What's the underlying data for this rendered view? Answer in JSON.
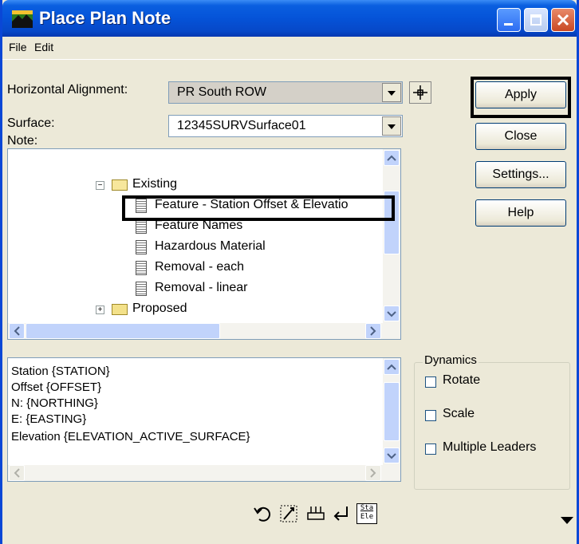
{
  "window": {
    "title": "Place Plan Note",
    "accent": "#0553d8"
  },
  "menu": {
    "file": "File",
    "edit": "Edit"
  },
  "form": {
    "alignment_label": "Horizontal Alignment:",
    "alignment_value": "PR South ROW",
    "surface_label": "Surface:",
    "surface_value": "12345SURVSurface01",
    "note_label": "Note:"
  },
  "buttons": {
    "apply": "Apply",
    "close": "Close",
    "settings": "Settings...",
    "help": "Help"
  },
  "tree": {
    "existing": "Existing",
    "items": [
      "Feature - Station Offset & Elevatio",
      "Feature Names",
      "Hazardous Material",
      "Removal - each",
      "Removal - linear"
    ],
    "proposed": "Proposed"
  },
  "note_text": {
    "lines": [
      "Station {STATION}",
      "Offset {OFFSET}",
      "N:  {NORTHING}",
      "E:  {EASTING}",
      "Elevation  {ELEVATION_ACTIVE_SURFACE}"
    ]
  },
  "dynamics": {
    "title": "Dynamics",
    "rotate": "Rotate",
    "scale": "Scale",
    "multiple_leaders": "Multiple Leaders",
    "rotate_checked": false,
    "scale_checked": false,
    "multiple_leaders_checked": false
  },
  "toolbar": {
    "icons": [
      "undo-icon",
      "rotate-text-icon",
      "insert-field-icon",
      "return-icon",
      "sta-ele-icon"
    ],
    "sta_top": "Sta",
    "sta_bottom": "Ele"
  }
}
